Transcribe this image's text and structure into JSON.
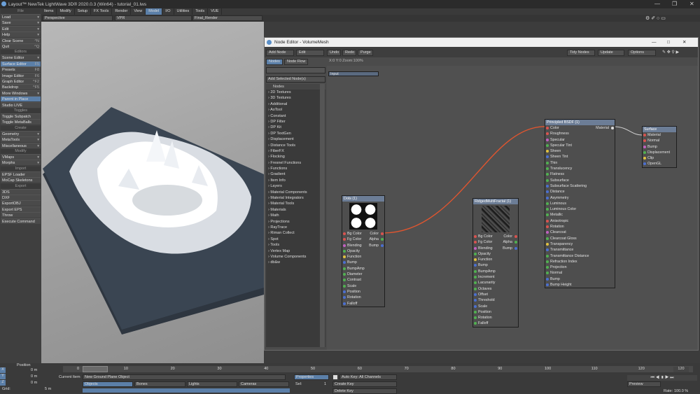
{
  "app": {
    "title": "Layout™ NewTek LightWave 3D® 2020.0.3 (Win64) - tutorial_01.lws"
  },
  "left_panel": {
    "sections": [
      {
        "header": "File",
        "items": [
          {
            "label": "Load",
            "arrow": true
          },
          {
            "label": "Save",
            "arrow": true
          },
          {
            "label": "Edit",
            "arrow": true
          },
          {
            "label": "Help",
            "arrow": true
          },
          {
            "label": "Clear Scene",
            "key": "^N"
          },
          {
            "label": "Quit",
            "key": "^Q"
          }
        ]
      },
      {
        "header": "Editors",
        "items": [
          {
            "label": "Scene Editor",
            "arrow": true
          },
          {
            "label": "Surface Editor",
            "key": "F5",
            "selected": true
          },
          {
            "label": "Presets",
            "key": "F8"
          },
          {
            "label": "Image Editor",
            "key": "F6"
          },
          {
            "label": "Graph Editor",
            "key": "^F2"
          },
          {
            "label": "Backdrop",
            "key": "^F5"
          },
          {
            "label": "More Windows",
            "arrow": true
          },
          {
            "label": "Parent in Place",
            "selected": true
          },
          {
            "label": "Studio LIVE"
          }
        ]
      },
      {
        "header": "Toggles",
        "items": [
          {
            "label": "Toggle Subpatch"
          },
          {
            "label": "Toggle MetaBalls"
          }
        ]
      },
      {
        "header": "Create",
        "items": [
          {
            "label": "Geometry",
            "arrow": true
          },
          {
            "label": "MetaTools",
            "arrow": true
          },
          {
            "label": "Miscellaneous",
            "arrow": true
          }
        ]
      },
      {
        "header": "Modify",
        "items": [
          {
            "label": "VMaps",
            "arrow": true
          },
          {
            "label": "Morphs",
            "arrow": true
          }
        ]
      },
      {
        "header": "Import",
        "items": [
          {
            "label": "EPSF Loader"
          },
          {
            "label": "MoCap Skeletons"
          }
        ]
      },
      {
        "header": "Export",
        "items": [
          {
            "label": "3DS"
          },
          {
            "label": "DXF"
          },
          {
            "label": "ExportOBJ"
          },
          {
            "label": "Export EPS"
          },
          {
            "label": "Throw"
          },
          {
            "label": "Execute Command"
          }
        ]
      }
    ]
  },
  "menu_tabs": [
    "Items",
    "Modify",
    "Setup",
    "FX Tools",
    "Render",
    "View",
    "Model",
    "I/O",
    "Utilities",
    "Tools",
    "VUE"
  ],
  "active_menu_tab": "Model",
  "viewport": {
    "view": "Perspective",
    "mode": "VPR",
    "render": "Final_Render"
  },
  "node_editor": {
    "title": "Node Editor - VolumeMesh",
    "toolbar": {
      "add_node": "Add Node",
      "edit": "Edit",
      "undo": "Undo",
      "redo": "Redo",
      "purge": "Purge",
      "tidy": "Tidy Nodes",
      "update": "Update",
      "options": "Options"
    },
    "tabs": [
      "Nodes",
      "Node Flow"
    ],
    "status": "X:0 Y:0 Zoom:100%",
    "add_selected": "Add Selected Node(s)",
    "list_header": "Nodes",
    "node_categories": [
      "2D Textures",
      "3D Textures",
      "Additional",
      "AoTool",
      "Constant",
      "DP Filter",
      "DP Kit",
      "DP TextGen",
      "Displacement",
      "Distance Tools",
      "FiberFX",
      "Flocking",
      "Fresnel Functions",
      "Functions",
      "Gradient",
      "Item Info",
      "Layers",
      "Material Components",
      "Material Integrators",
      "Material Tools",
      "Materials",
      "Math",
      "Projections",
      "RayTrace",
      "Riman Collect",
      "Spot",
      "Tools",
      "Vertex Map",
      "Volume Components",
      "db&w"
    ],
    "input_node": "Input",
    "dots_node": {
      "title": "Dots (1)",
      "inputs": [
        "Bg Color",
        "Fg Color",
        "Blending",
        "Opacity",
        "Function",
        "Bump",
        "BumpAmp",
        "Diameter",
        "Contrast",
        "Scale",
        "Position",
        "Rotation",
        "Falloff"
      ],
      "outputs": [
        "Color",
        "Alpha",
        "Bump"
      ]
    },
    "ridged_node": {
      "title": "RidgedMultiFractal (1)",
      "inputs": [
        "Bg Color",
        "Fg Color",
        "Blending",
        "Opacity",
        "Function",
        "Bump",
        "BumpAmp",
        "Increment",
        "Lacunarity",
        "Octaves",
        "Offset",
        "Threshold",
        "Scale",
        "Position",
        "Rotation",
        "Falloff"
      ],
      "outputs": [
        "Color",
        "Alpha",
        "Bump"
      ]
    },
    "bsdf_node": {
      "title": "Principled BSDF (1)",
      "inputs": [
        "Color",
        "Roughness",
        "Specular",
        "Specular Tint",
        "Sheen",
        "Sheen Tint",
        "Thin",
        "Translucency",
        "Flatness",
        "Subsurface",
        "Subsurface Scattering",
        "Distance",
        "Asymmetry",
        "Luminous",
        "Luminous Color",
        "Metallic",
        "Anisotropic",
        "Rotation",
        "Clearcoat",
        "Clearcoat Gloss",
        "Transparency",
        "Transmittance",
        "Transmittance Distance",
        "Refraction Index",
        "Projection",
        "Normal",
        "Bump",
        "Bump Height"
      ],
      "output": "Material"
    },
    "surface_node": {
      "title": "Surface",
      "inputs": [
        "Material",
        "Normal",
        "Bump",
        "Displacement",
        "Clip",
        "OpenGL"
      ]
    }
  },
  "timeline": {
    "ticks": [
      "0",
      "10",
      "20",
      "30",
      "40",
      "50",
      "60",
      "70",
      "80",
      "90",
      "100",
      "110",
      "120"
    ],
    "end": "120",
    "current": "0"
  },
  "bottom": {
    "x_label": "X",
    "y_label": "Y",
    "z_label": "Z",
    "x_val": "0 m",
    "y_val": "0 m",
    "z_val": "0 m",
    "position": "Position",
    "grid_label": "Grid:",
    "grid_val": "5 m",
    "current_item_label": "Current Item",
    "current_item": "New Ground Plane Object",
    "objects": "Objects",
    "bones": "Bones",
    "lights": "Lights",
    "cameras": "Cameras",
    "properties": "Properties",
    "sel_label": "Sel:",
    "sel_val": "1",
    "auto_key": "Auto Key: All Channels",
    "create_key": "Create Key",
    "delete_key": "Delete Key",
    "preview": "Preview",
    "rate_label": "Rate:",
    "rate_val": "100.0 %"
  }
}
